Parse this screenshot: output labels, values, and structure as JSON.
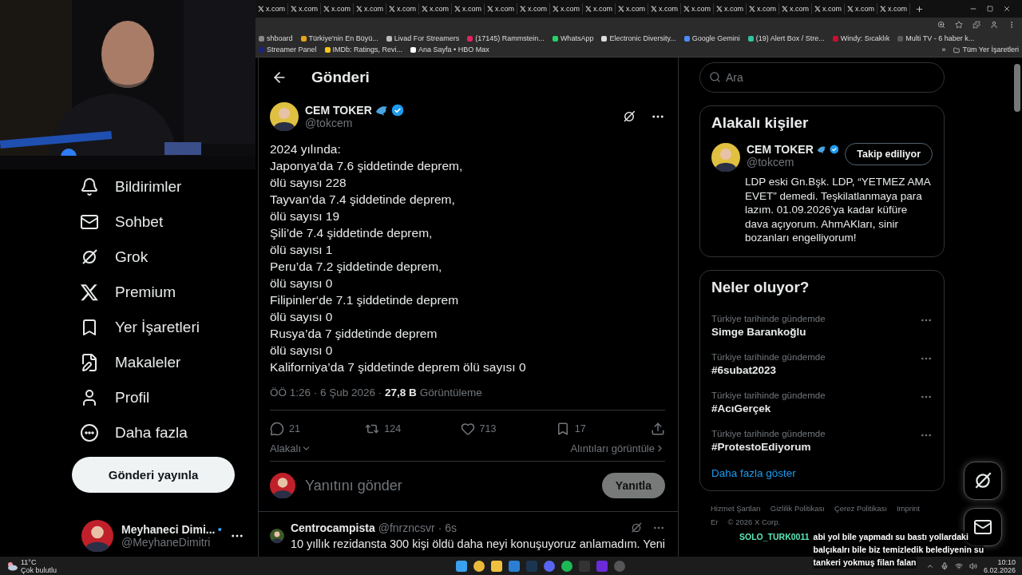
{
  "browser": {
    "tabs": [
      "x.com",
      "x.com",
      "x.com",
      "x.com",
      "x.com",
      "x.com",
      "x.com",
      "x.com",
      "x.com",
      "x.com",
      "x.com",
      "x.com",
      "x.com",
      "x.com",
      "x.com",
      "x.com",
      "x.com",
      "x.com",
      "x.com",
      "x.com"
    ],
    "bookmarks": [
      {
        "label": "shboard",
        "color": "#888888"
      },
      {
        "label": "Türkiye'nin En Büyü...",
        "color": "#e8a317"
      },
      {
        "label": "Livad For Streamers",
        "color": "#bbbbbb"
      },
      {
        "label": "(17145) Rammstein...",
        "color": "#e0245e"
      },
      {
        "label": "WhatsApp",
        "color": "#25d366"
      },
      {
        "label": "Electronic Diversity...",
        "color": "#dddddd"
      },
      {
        "label": "Google Gemini",
        "color": "#4b8df8"
      },
      {
        "label": "(19) Alert Box / Stre...",
        "color": "#31c3a2"
      },
      {
        "label": "Windy: Sıcaklık",
        "color": "#c8102e"
      },
      {
        "label": "Multi TV - 6 haber k...",
        "color": "#5a5a5a"
      },
      {
        "label": "Streamer Panel",
        "color": "#1a237e"
      },
      {
        "label": "IMDb: Ratings, Revi...",
        "color": "#f5c518"
      },
      {
        "label": "Ana Sayfa • HBO Max",
        "color": "#ffffff"
      }
    ],
    "more": "»",
    "all_bookmarks": "Tüm Yer İşaretleri"
  },
  "nav": {
    "items": [
      {
        "label": "Bildirimler"
      },
      {
        "label": "Sohbet"
      },
      {
        "label": "Grok"
      },
      {
        "label": "Premium"
      },
      {
        "label": "Yer İşaretleri"
      },
      {
        "label": "Makaleler"
      },
      {
        "label": "Profil"
      },
      {
        "label": "Daha fazla"
      }
    ],
    "post_button": "Gönderi yayınla",
    "account": {
      "name": "Meyhaneci Dimi...",
      "handle": "@MeyhaneDimitri"
    }
  },
  "header": {
    "title": "Gönderi"
  },
  "post": {
    "author": "CEM TOKER",
    "handle": "@tokcem",
    "lines": [
      "2024 yılında:",
      "Japonya’da 7.6 şiddetinde deprem,",
      "ölü sayısı 228",
      "Tayvan’da 7.4 şiddetinde deprem,",
      "ölü sayısı 19",
      "Şili’de 7.4 şiddetinde deprem,",
      "ölü sayısı 1",
      "Peru’da 7.2 şiddetinde deprem,",
      "ölü sayısı 0",
      "Filipinler‘de 7.1 şiddetinde deprem",
      "ölü sayısı 0",
      "Rusya’da 7 şiddetinde deprem",
      "ölü sayısı 0",
      "Kaliforniya’da 7 şiddetinde deprem ölü sayısı 0"
    ],
    "meta": "ÖÖ 1:26 · 6 Şub 2026 · **27,8 B** Görüntüleme",
    "actions": [
      {
        "kind": "reply",
        "count": "21"
      },
      {
        "kind": "repost",
        "count": "124"
      },
      {
        "kind": "like",
        "count": "713"
      },
      {
        "kind": "bookmark",
        "count": "17"
      },
      {
        "kind": "share"
      }
    ],
    "sort": "Alakalı",
    "quotes": "Alıntıları görüntüle",
    "reply_placeholder": "Yanıtını gönder",
    "reply_button": "Yanıtla"
  },
  "reply": {
    "author": "Centrocampista",
    "handle": "@fnrzncsvr",
    "time": "· 6s",
    "text": "10 yıllık rezidansta 300 kişi öldü daha neyi konuşuyoruz anlamadım. Yeni"
  },
  "search": {
    "placeholder": "Ara"
  },
  "related": {
    "title": "Alakalı kişiler",
    "name": "CEM TOKER",
    "handle": "@tokcem",
    "follow": "Takip ediliyor",
    "bio": "LDP eski Gn.Bşk. LDP, “YETMEZ AMA EVET” demedi. Teşkilatlanmaya para lazım. 01.09.2026’ya kadar küfüre dava açıyorum. AhmAKları, sinir bozanları engelliyorum!"
  },
  "trends": {
    "title": "Neler oluyor?",
    "items": [
      {
        "context": "Türkiye tarihinde gündemde",
        "topic": "Simge Barankoğlu"
      },
      {
        "context": "Türkiye tarihinde gündemde",
        "topic": "#6subat2023"
      },
      {
        "context": "Türkiye tarihinde gündemde",
        "topic": "#AcıGerçek"
      },
      {
        "context": "Türkiye tarihinde gündemde",
        "topic": "#ProtestoEdiyorum"
      }
    ],
    "more": "Daha fazla göster"
  },
  "footer": [
    "Hizmet Şartları",
    "Gizlilik Politikası",
    "Çerez Politikası",
    "Imprint",
    "Er"
  ],
  "copyright": "© 2026 X Corp.",
  "chat": {
    "user": "SOLO_TURK0011",
    "lines": [
      "abi yol bile yapmadı su bastı yollardaki",
      "balçıkalrı bile biz temizledik belediyenin su",
      "tankeri yokmuş filan falan"
    ]
  },
  "taskbar": {
    "temperature": "11°C",
    "weather": "Çok bulutlu",
    "time": "10:10",
    "date": "6.02.2026"
  }
}
